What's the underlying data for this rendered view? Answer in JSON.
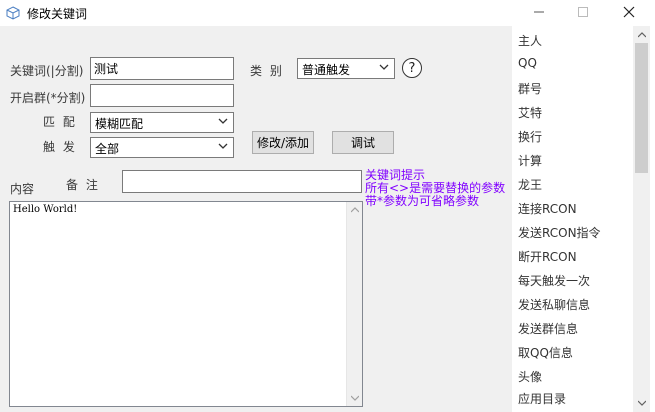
{
  "window": {
    "title": "修改关键词"
  },
  "form": {
    "keyword_label": "关键词(|分割)",
    "keyword_value": "测试",
    "category_label": "类  别",
    "category_value": "普通触发",
    "help_symbol": "?",
    "groups_label": "开启群(*分割)",
    "groups_value": "",
    "match_label": "匹  配",
    "match_value": "模糊匹配",
    "trigger_label": "触  发",
    "trigger_value": "全部",
    "modify_add_label": "修改/添加",
    "debug_label": "调试",
    "content_label": "内容",
    "remark_label": "备  注",
    "remark_value": "",
    "hint_lines": [
      "关键词提示",
      "所有<>是需要替换的参数",
      "带*参数为可省略参数"
    ],
    "content_text": "Hello World!"
  },
  "list": {
    "items": [
      "主人",
      "QQ",
      "群号",
      "艾特",
      "换行",
      "计算",
      "龙王",
      "连接RCON",
      "发送RCON指令",
      "断开RCON",
      "每天触发一次",
      "发送私聊信息",
      "发送群信息",
      "取QQ信息",
      "头像",
      "应用目录"
    ]
  },
  "icons": [
    "app-cube-icon",
    "minimize-icon",
    "maximize-icon",
    "close-icon",
    "chevron-down-icon",
    "scroll-up-icon",
    "scroll-down-icon"
  ]
}
